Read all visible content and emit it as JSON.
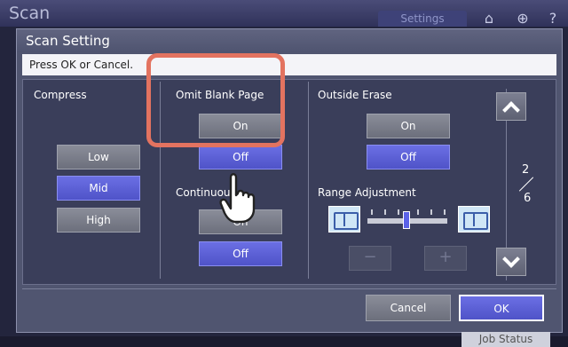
{
  "app": {
    "title": "Scan",
    "settings_tab": "Settings"
  },
  "dialog": {
    "title": "Scan Setting",
    "message": "Press OK or Cancel."
  },
  "compress": {
    "label": "Compress",
    "options": [
      "Low",
      "Mid",
      "High"
    ],
    "selected": "Mid"
  },
  "omit_blank_page": {
    "label": "Omit Blank Page",
    "on": "On",
    "off": "Off",
    "selected": "Off"
  },
  "continuous": {
    "label": "Continuous",
    "on": "On",
    "off": "Off",
    "selected": "Off"
  },
  "outside_erase": {
    "label": "Outside Erase",
    "on": "On",
    "off": "Off",
    "selected": "Off"
  },
  "range_adjustment": {
    "label": "Range Adjustment",
    "minus": "−",
    "plus": "+"
  },
  "pager": {
    "current": "2",
    "total": "6"
  },
  "footer": {
    "cancel": "Cancel",
    "ok": "OK"
  },
  "status": {
    "job_status": "Job Status"
  },
  "colors": {
    "selected": "#5a5ed8",
    "highlight": "#e37360"
  },
  "icons": [
    "home-icon",
    "globe-icon",
    "help-icon",
    "chevron-up-icon",
    "chevron-down-icon",
    "book-open-icon",
    "pointing-hand-icon"
  ]
}
